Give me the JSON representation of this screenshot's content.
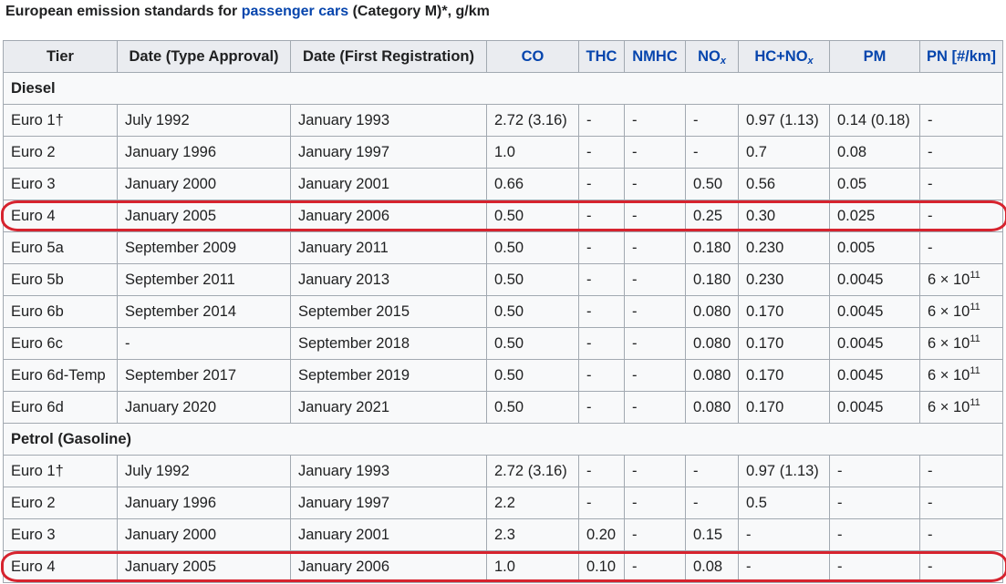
{
  "caption": {
    "prefix": "European emission standards for ",
    "link": "passenger cars",
    "suffix": " (Category M)*, g/km"
  },
  "columns": {
    "tier": "Tier",
    "date_ta": "Date (Type Approval)",
    "date_fr": "Date (First Registration)",
    "co": "CO",
    "thc": "THC",
    "nmhc": "NMHC",
    "nox_base": "NO",
    "nox_sub": "x",
    "hcnox_base": "HC+NO",
    "hcnox_sub": "x",
    "pm": "PM",
    "pn": "PN [#/km]"
  },
  "sections": {
    "diesel": "Diesel",
    "petrol": "Petrol (Gasoline)"
  },
  "diesel_rows": [
    {
      "tier": "Euro 1†",
      "ta": "July 1992",
      "fr": "January 1993",
      "co": "2.72 (3.16)",
      "thc": "-",
      "nmhc": "-",
      "nox": "-",
      "hcnox": "0.97 (1.13)",
      "pm": "0.14 (0.18)",
      "pn": "-"
    },
    {
      "tier": "Euro 2",
      "ta": "January 1996",
      "fr": "January 1997",
      "co": "1.0",
      "thc": "-",
      "nmhc": "-",
      "nox": "-",
      "hcnox": "0.7",
      "pm": "0.08",
      "pn": "-"
    },
    {
      "tier": "Euro 3",
      "ta": "January 2000",
      "fr": "January 2001",
      "co": "0.66",
      "thc": "-",
      "nmhc": "-",
      "nox": "0.50",
      "hcnox": "0.56",
      "pm": "0.05",
      "pn": "-"
    },
    {
      "tier": "Euro 4",
      "ta": "January 2005",
      "fr": "January 2006",
      "co": "0.50",
      "thc": "-",
      "nmhc": "-",
      "nox": "0.25",
      "hcnox": "0.30",
      "pm": "0.025",
      "pn": "-"
    },
    {
      "tier": "Euro 5a",
      "ta": "September 2009",
      "fr": "January 2011",
      "co": "0.50",
      "thc": "-",
      "nmhc": "-",
      "nox": "0.180",
      "hcnox": "0.230",
      "pm": "0.005",
      "pn": "-"
    },
    {
      "tier": "Euro 5b",
      "ta": "September 2011",
      "fr": "January 2013",
      "co": "0.50",
      "thc": "-",
      "nmhc": "-",
      "nox": "0.180",
      "hcnox": "0.230",
      "pm": "0.0045",
      "pn": "6 × 10",
      "pn_exp": "11"
    },
    {
      "tier": "Euro 6b",
      "ta": "September 2014",
      "fr": "September 2015",
      "co": "0.50",
      "thc": "-",
      "nmhc": "-",
      "nox": "0.080",
      "hcnox": "0.170",
      "pm": "0.0045",
      "pn": "6 × 10",
      "pn_exp": "11"
    },
    {
      "tier": "Euro 6c",
      "ta": "-",
      "fr": "September 2018",
      "co": "0.50",
      "thc": "-",
      "nmhc": "-",
      "nox": "0.080",
      "hcnox": "0.170",
      "pm": "0.0045",
      "pn": "6 × 10",
      "pn_exp": "11"
    },
    {
      "tier": "Euro 6d-Temp",
      "ta": "September 2017",
      "fr": "September 2019",
      "co": "0.50",
      "thc": "-",
      "nmhc": "-",
      "nox": "0.080",
      "hcnox": "0.170",
      "pm": "0.0045",
      "pn": "6 × 10",
      "pn_exp": "11"
    },
    {
      "tier": "Euro 6d",
      "ta": "January 2020",
      "fr": "January 2021",
      "co": "0.50",
      "thc": "-",
      "nmhc": "-",
      "nox": "0.080",
      "hcnox": "0.170",
      "pm": "0.0045",
      "pn": "6 × 10",
      "pn_exp": "11"
    }
  ],
  "petrol_rows": [
    {
      "tier": "Euro 1†",
      "ta": "July 1992",
      "fr": "January 1993",
      "co": "2.72 (3.16)",
      "thc": "-",
      "nmhc": "-",
      "nox": "-",
      "hcnox": "0.97 (1.13)",
      "pm": "-",
      "pn": "-"
    },
    {
      "tier": "Euro 2",
      "ta": "January 1996",
      "fr": "January 1997",
      "co": "2.2",
      "thc": "-",
      "nmhc": "-",
      "nox": "-",
      "hcnox": "0.5",
      "pm": "-",
      "pn": "-"
    },
    {
      "tier": "Euro 3",
      "ta": "January 2000",
      "fr": "January 2001",
      "co": "2.3",
      "thc": "0.20",
      "nmhc": "-",
      "nox": "0.15",
      "hcnox": "-",
      "pm": "-",
      "pn": "-"
    },
    {
      "tier": "Euro 4",
      "ta": "January 2005",
      "fr": "January 2006",
      "co": "1.0",
      "thc": "0.10",
      "nmhc": "-",
      "nox": "0.08",
      "hcnox": "-",
      "pm": "-",
      "pn": "-"
    }
  ],
  "highlight_color": "#d6232e",
  "link_color": "#0645ad"
}
